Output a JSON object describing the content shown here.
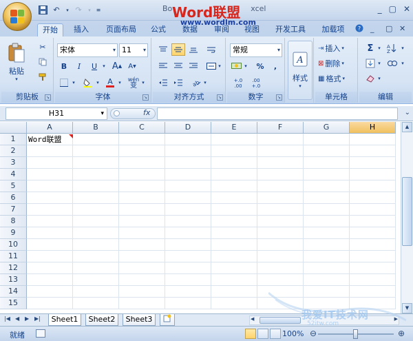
{
  "window": {
    "title": "Bo...x - Microsoft Excel",
    "title_left": "Bo",
    "title_right": "xcel",
    "watermark_logo_latin": "Word",
    "watermark_logo_cjk": "联盟",
    "watermark_url": "www.wordlm.com",
    "controls": [
      "_",
      "▢",
      "✕"
    ]
  },
  "quick_access": {
    "save_icon": "save-icon",
    "undo_label": "↶",
    "redo_label": "↷"
  },
  "tabs": [
    {
      "label": "开始",
      "active": true
    },
    {
      "label": "插入"
    },
    {
      "label": "页面布局"
    },
    {
      "label": "公式"
    },
    {
      "label": "数据"
    },
    {
      "label": "审阅"
    },
    {
      "label": "视图"
    },
    {
      "label": "开发工具"
    },
    {
      "label": "加载项"
    }
  ],
  "tab_right_controls": [
    "?",
    "_",
    "▢",
    "✕"
  ],
  "ribbon": {
    "clipboard": {
      "paste_label": "粘贴",
      "group_label": "剪贴板"
    },
    "font": {
      "font_name": "宋体",
      "font_size": "11",
      "bold": "B",
      "italic": "I",
      "underline": "U",
      "grow": "A",
      "shrink": "A",
      "font_color": "A",
      "phonetic": "wén",
      "phonetic_sub": "变",
      "group_label": "字体"
    },
    "alignment": {
      "group_label": "对齐方式"
    },
    "number": {
      "format": "常规",
      "currency": "$",
      "percent": "%",
      "comma": ",",
      "inc_decimal": "+.0",
      "inc_decimal_sub": ".00",
      "dec_decimal": ".00",
      "dec_decimal_sub": "+.0",
      "group_label": "数字"
    },
    "styles": {
      "label": "样式"
    },
    "cells": {
      "insert": "插入",
      "delete": "删除",
      "format": "格式",
      "group_label": "单元格"
    },
    "editing": {
      "sum": "Σ",
      "group_label": "编辑"
    }
  },
  "formula_bar": {
    "name_box": "H31",
    "fx": "fx",
    "formula": ""
  },
  "sheet": {
    "columns": [
      "A",
      "B",
      "C",
      "D",
      "E",
      "F",
      "G",
      "H"
    ],
    "selected_column": "H",
    "rows": [
      "1",
      "2",
      "3",
      "4",
      "5",
      "6",
      "7",
      "8",
      "9",
      "10",
      "11",
      "12",
      "13",
      "14",
      "15"
    ],
    "cell_a1": "Word联盟"
  },
  "sheet_tabs": [
    {
      "label": "Sheet1",
      "active": true
    },
    {
      "label": "Sheet2"
    },
    {
      "label": "Sheet3"
    }
  ],
  "status": {
    "ready": "就绪",
    "zoom": "100%",
    "zoom_level": 1.0
  },
  "watermark2": {
    "text": "我爱IT技术网",
    "sub": "52itw.com"
  },
  "colors": {
    "accent": "#15428b",
    "selected_header": "#f1c15f",
    "comment_marker": "#e0201c"
  }
}
